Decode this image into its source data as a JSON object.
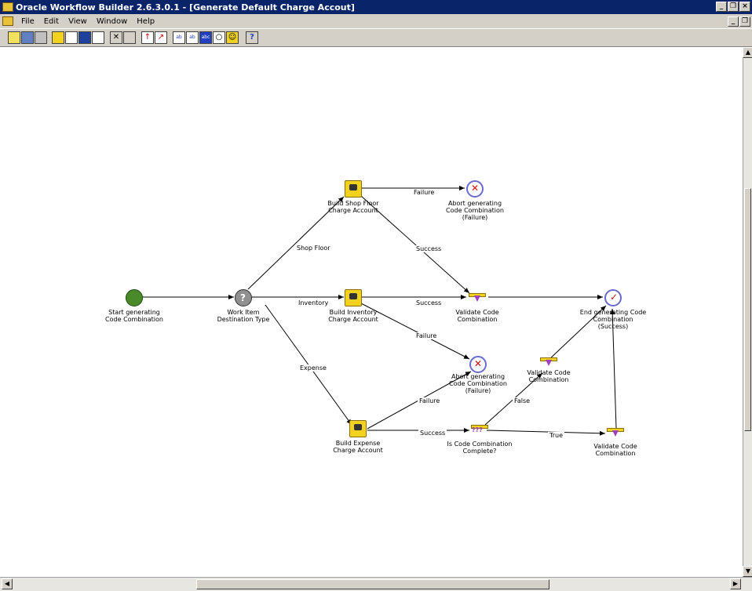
{
  "window": {
    "title": "Oracle Workflow Builder 2.6.3.0.1 - [Generate Default Charge Accout]"
  },
  "menu": {
    "items": [
      "File",
      "Edit",
      "View",
      "Window",
      "Help"
    ]
  },
  "toolbar": {
    "buttons": [
      {
        "icon": "open-folder-icon"
      },
      {
        "icon": "save-icon"
      },
      {
        "icon": "print-icon"
      },
      {
        "icon": "new-process-icon"
      },
      {
        "icon": "message-icon"
      },
      {
        "icon": "lookup-icon"
      },
      {
        "icon": "function-icon"
      },
      {
        "icon": "delete-icon"
      },
      {
        "icon": "properties-icon"
      },
      {
        "icon": "transition-icon"
      },
      {
        "icon": "arrow-tool-icon"
      },
      {
        "icon": "label-icon"
      },
      {
        "icon": "label-alt-icon"
      },
      {
        "icon": "abc-label-icon"
      },
      {
        "icon": "find-icon"
      },
      {
        "icon": "zoom-icon"
      },
      {
        "icon": "help-icon"
      }
    ],
    "help_label": "?"
  },
  "diagram": {
    "nodes": [
      {
        "id": "start",
        "type": "start",
        "label": "Start generating\nCode Combination"
      },
      {
        "id": "workitem",
        "type": "notify",
        "label": "Work Item\nDestination Type"
      },
      {
        "id": "shopfloor",
        "type": "function",
        "label": "Build Shop Floor\nCharge Account"
      },
      {
        "id": "abort1",
        "type": "abort",
        "label": "Abort generating\nCode Combination\n(Failure)"
      },
      {
        "id": "inventory",
        "type": "function",
        "label": "Build Inventory\nCharge Account"
      },
      {
        "id": "validate1",
        "type": "validate",
        "label": "Validate Code\nCombination"
      },
      {
        "id": "end",
        "type": "end",
        "label": "End generating Code\nCombination\n(Success)"
      },
      {
        "id": "abort2",
        "type": "abort",
        "label": "Abort generating\nCode Combination\n(Failure)"
      },
      {
        "id": "validate2",
        "type": "validate",
        "label": "Validate Code\nCombination"
      },
      {
        "id": "expense",
        "type": "function",
        "label": "Build Expense\nCharge Account"
      },
      {
        "id": "complete",
        "type": "compare",
        "label": "Is Code Combination\nComplete?"
      },
      {
        "id": "validate3",
        "type": "validate",
        "label": "Validate Code\nCombination"
      }
    ],
    "edges": [
      {
        "id": "e1",
        "from": "start",
        "to": "workitem",
        "label": ""
      },
      {
        "id": "e2",
        "from": "workitem",
        "to": "shopfloor",
        "label": "Shop Floor"
      },
      {
        "id": "e3",
        "from": "workitem",
        "to": "inventory",
        "label": "Inventory"
      },
      {
        "id": "e4",
        "from": "workitem",
        "to": "expense",
        "label": "Expense"
      },
      {
        "id": "e5",
        "from": "shopfloor",
        "to": "abort1",
        "label": "Failure"
      },
      {
        "id": "e6",
        "from": "shopfloor",
        "to": "validate1",
        "label": "Success"
      },
      {
        "id": "e7",
        "from": "inventory",
        "to": "validate1",
        "label": "Success"
      },
      {
        "id": "e8",
        "from": "inventory",
        "to": "abort2",
        "label": "Failure"
      },
      {
        "id": "e9",
        "from": "validate1",
        "to": "end",
        "label": ""
      },
      {
        "id": "e10",
        "from": "expense",
        "to": "abort2",
        "label": "Failure"
      },
      {
        "id": "e11",
        "from": "expense",
        "to": "complete",
        "label": "Success"
      },
      {
        "id": "e12",
        "from": "complete",
        "to": "validate2",
        "label": "False"
      },
      {
        "id": "e13",
        "from": "complete",
        "to": "validate3",
        "label": "True"
      },
      {
        "id": "e14",
        "from": "validate2",
        "to": "end",
        "label": ""
      },
      {
        "id": "e15",
        "from": "validate3",
        "to": "end",
        "label": ""
      }
    ]
  }
}
